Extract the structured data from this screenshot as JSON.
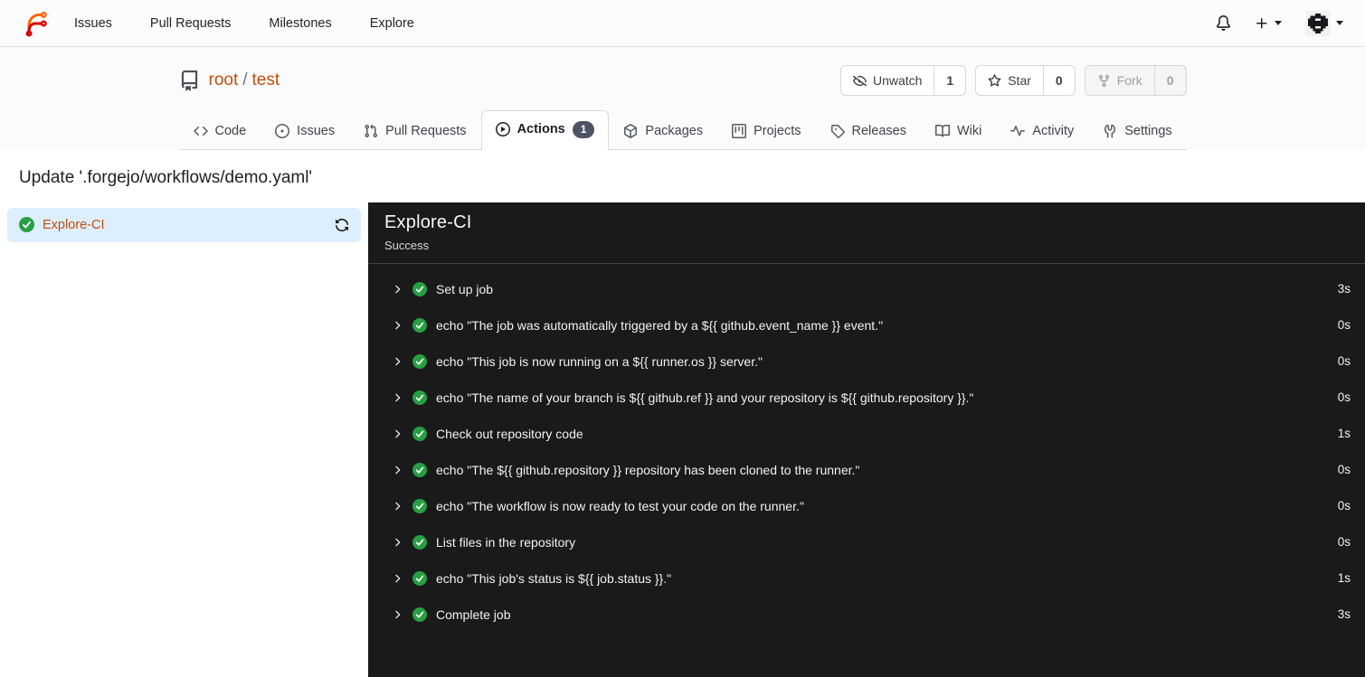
{
  "colors": {
    "accent_link": "#c24e0e",
    "success_green": "#279f43",
    "panel_bg": "#1a1a1a",
    "selected_job_bg": "#ddeefd",
    "badge_bg": "#4d5364"
  },
  "nav": {
    "links": [
      {
        "label": "Issues"
      },
      {
        "label": "Pull Requests"
      },
      {
        "label": "Milestones"
      },
      {
        "label": "Explore"
      }
    ],
    "icons": [
      "notifications-bell",
      "create-plus",
      "user-avatar"
    ]
  },
  "repo": {
    "owner": "root",
    "separator": "/",
    "name": "test",
    "buttons": [
      {
        "label": "Unwatch",
        "count": "1",
        "icon": "eye-closed"
      },
      {
        "label": "Star",
        "count": "0",
        "icon": "star"
      },
      {
        "label": "Fork",
        "count": "0",
        "icon": "git-fork",
        "disabled": true
      }
    ],
    "tabs": [
      {
        "label": "Code",
        "icon": "code"
      },
      {
        "label": "Issues",
        "icon": "issue-circle"
      },
      {
        "label": "Pull Requests",
        "icon": "git-pull-request"
      },
      {
        "label": "Actions",
        "icon": "play-circle",
        "badge": "1",
        "active": true
      },
      {
        "label": "Packages",
        "icon": "package"
      },
      {
        "label": "Projects",
        "icon": "project-board"
      },
      {
        "label": "Releases",
        "icon": "tag"
      },
      {
        "label": "Wiki",
        "icon": "book-open"
      },
      {
        "label": "Activity",
        "icon": "pulse"
      },
      {
        "label": "Settings",
        "icon": "tools"
      }
    ]
  },
  "run": {
    "title": "Update '.forgejo/workflows/demo.yaml'",
    "job": {
      "name": "Explore-CI",
      "status_icon": "check-circle-green",
      "rerun_icon": "sync-arrows"
    },
    "panel": {
      "job_name": "Explore-CI",
      "status": "Success"
    },
    "steps": [
      {
        "name": "Set up job",
        "duration": "3s"
      },
      {
        "name": "echo \"The job was automatically triggered by a ${{ github.event_name }} event.\"",
        "duration": "0s"
      },
      {
        "name": "echo \"This job is now running on a ${{ runner.os }} server.\"",
        "duration": "0s"
      },
      {
        "name": "echo \"The name of your branch is ${{ github.ref }} and your repository is ${{ github.repository }}.\"",
        "duration": "0s"
      },
      {
        "name": "Check out repository code",
        "duration": "1s"
      },
      {
        "name": "echo \"The ${{ github.repository }} repository has been cloned to the runner.\"",
        "duration": "0s"
      },
      {
        "name": "echo \"The workflow is now ready to test your code on the runner.\"",
        "duration": "0s"
      },
      {
        "name": "List files in the repository",
        "duration": "0s"
      },
      {
        "name": "echo \"This job's status is ${{ job.status }}.\"",
        "duration": "1s"
      },
      {
        "name": "Complete job",
        "duration": "3s"
      }
    ]
  }
}
